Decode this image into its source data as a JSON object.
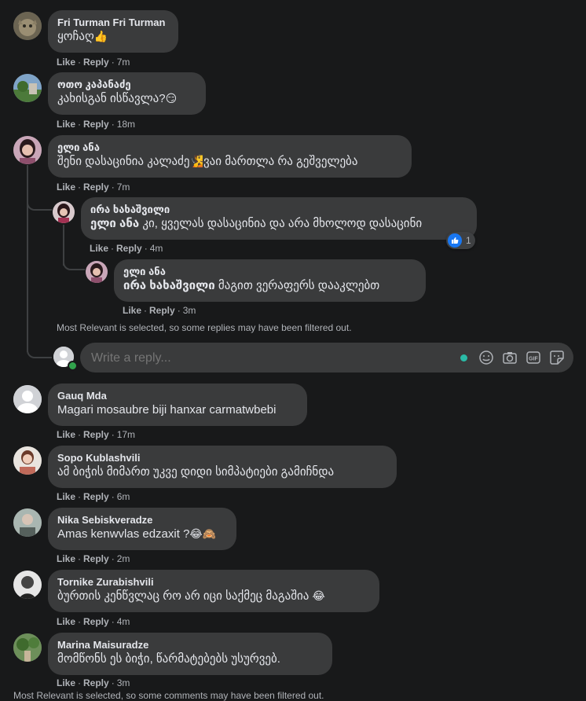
{
  "labels": {
    "like": "Like",
    "reply": "Reply"
  },
  "comments": [
    {
      "author": "Fri Turman Fri Turman",
      "text": "ყოჩაღ",
      "time": "7m"
    },
    {
      "author": "ოთო კაპანაძე",
      "text": "კახისგან ისწავლა?",
      "time": "18m"
    },
    {
      "author": "ელი ანა",
      "text": "შენი დასაცინია კალაძე",
      "text2": "ვაი მართლა რა გეშველება",
      "time": "7m"
    },
    {
      "author": "ირა ხახაშვილი",
      "mention": "ელი ანა",
      "text": "კი, ყველას დასაცინია და არა მხოლოდ დასაცინი",
      "time": "4m",
      "reaction_count": "1"
    },
    {
      "author": "ელი ანა",
      "mention": "ირა ხახაშვილი",
      "text": "მაგით ვერაფერს დააკლებთ",
      "time": "3m"
    },
    {
      "author": "Gauq Mda",
      "text": "Magari mosaubre biji hanxar carmatwbebi",
      "time": "17m"
    },
    {
      "author": "Sopo Kublashvili",
      "text": "ამ ბიჭის მიმართ უკვე დიდი სიმპატიები გამიჩნდა",
      "time": "6m"
    },
    {
      "author": "Nika Sebiskveradze",
      "text": "Amas kenwvlas edzaxit ?",
      "time": "2m"
    },
    {
      "author": "Tornike Zurabishvili",
      "text": "ბურთის კენწვლაც რო არ იცი საქმეც მაგაშია",
      "time": "4m"
    },
    {
      "author": "Marina Maisuradze",
      "text": "მომწონს ეს ბიჭი, წარმატებებს უსურვებ.",
      "time": "3m"
    }
  ],
  "thread_filtered_note": "Most Relevant is selected, so some replies may have been filtered out.",
  "bottom_filtered_note": "Most Relevant is selected, so some comments may have been filtered out.",
  "reply_box": {
    "placeholder": "Write a reply..."
  },
  "icons": {
    "emoji": "emoji-icon",
    "camera": "camera-icon",
    "gif": "gif-icon",
    "sticker": "sticker-icon"
  },
  "colors": {
    "accent": "#1877f2",
    "online": "#31a24c",
    "bubble": "#3a3b3c",
    "background": "#18191a"
  }
}
